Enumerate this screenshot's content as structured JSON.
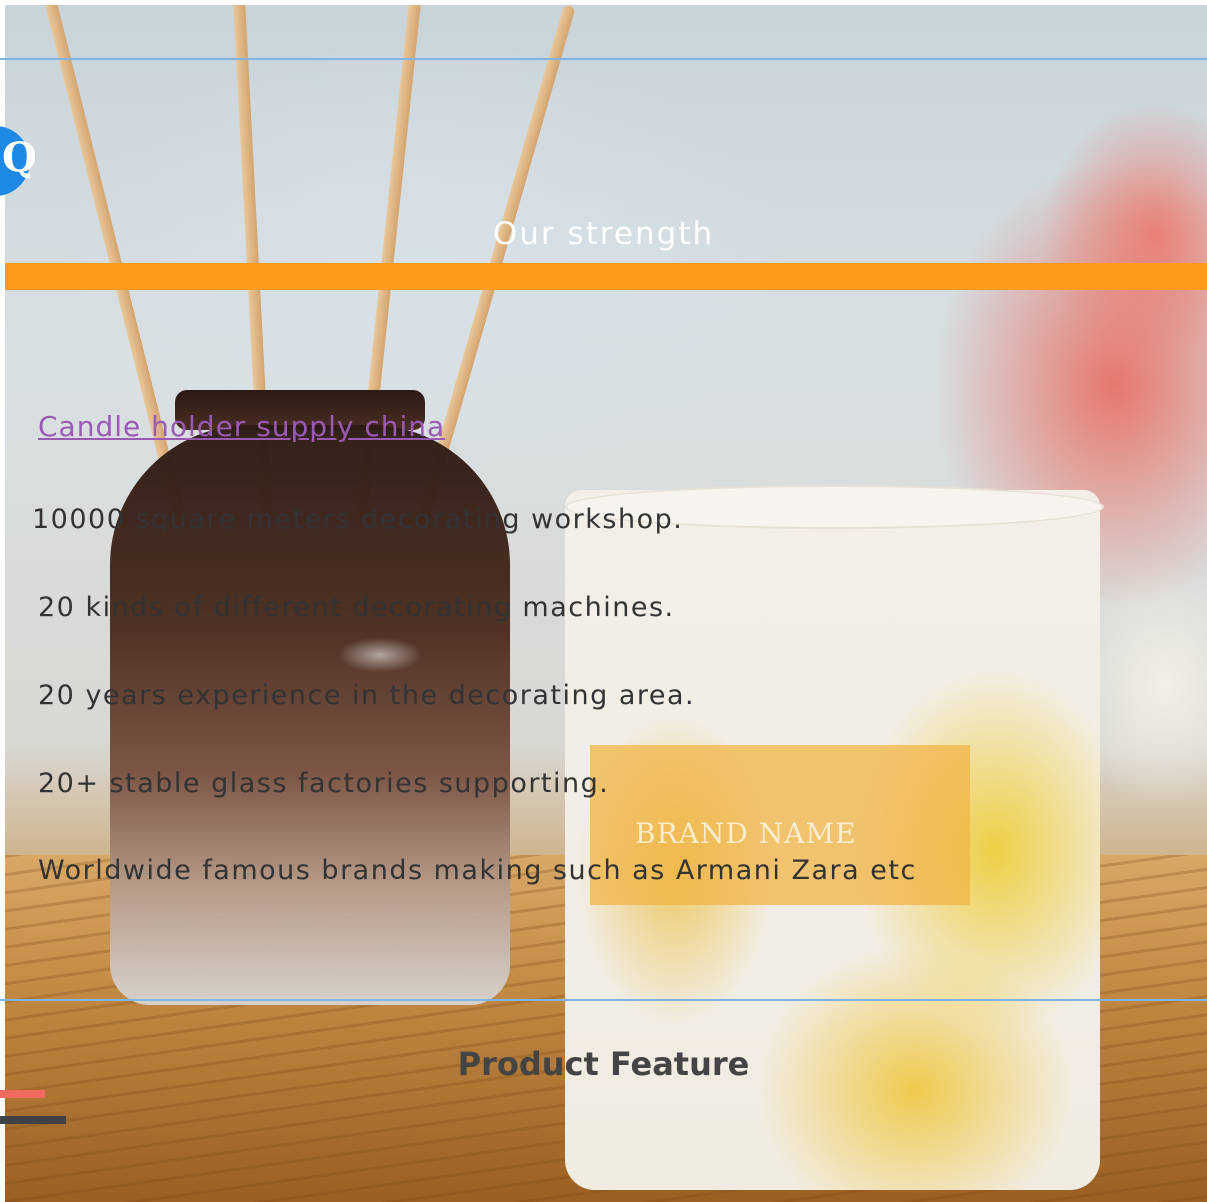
{
  "q_badge": "Q",
  "strength": {
    "title": "Our strength"
  },
  "link": {
    "text": "Candle holder supply china"
  },
  "points": [
    "10000 square meters decorating workshop.",
    "20 kinds of different decorating machines.",
    "20 years experience in the decorating area.",
    "20+ stable glass factories supporting.",
    "Worldwide famous brands making such as Armani Zara etc"
  ],
  "jar_label": "BRAND NAME",
  "feature": {
    "title": "Product Feature"
  },
  "colors": {
    "accent_orange": "#ff9a1a",
    "line_blue": "#7fb4e6",
    "badge_blue": "#1e88e5",
    "link_purple": "#9b59b6",
    "deco_red": "#ef6b5f",
    "deco_dark": "#3d4148"
  }
}
